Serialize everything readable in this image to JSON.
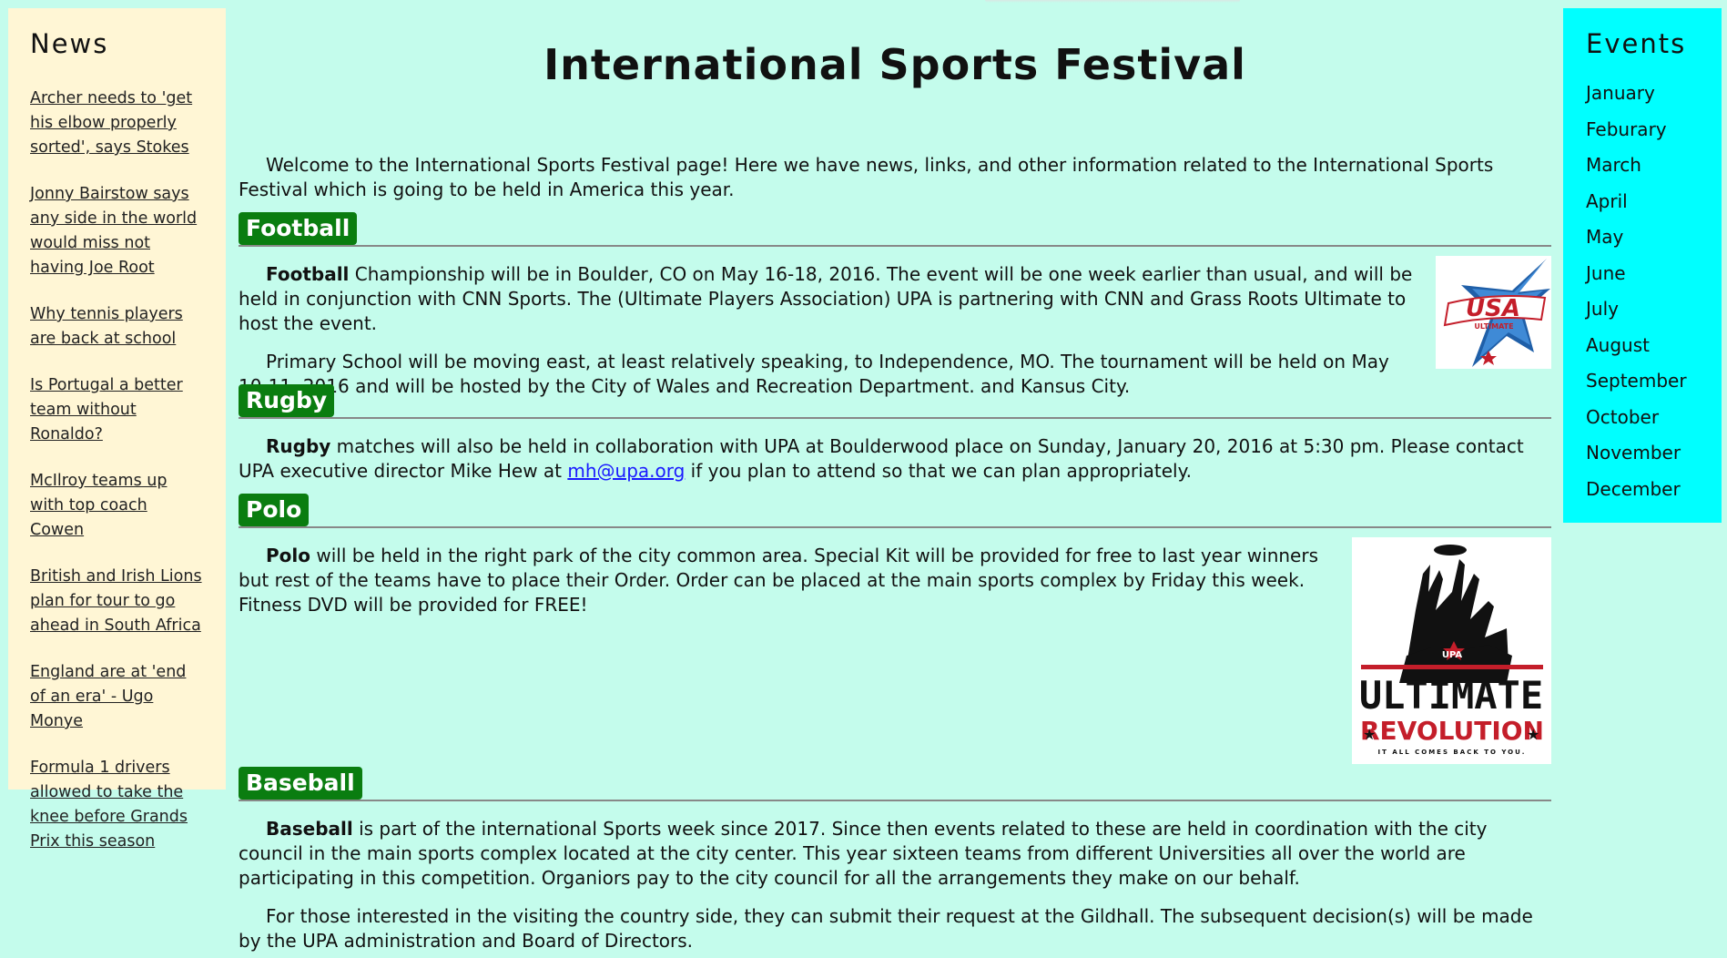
{
  "news": {
    "title": "News",
    "items": [
      "Archer needs to 'get his elbow properly sorted', says Stokes",
      "Jonny Bairstow says any side in the world would miss not having Joe Root",
      "Why tennis players are back at school",
      "Is Portugal a better team without Ronaldo?",
      "McIlroy teams up with top coach Cowen",
      "British and Irish Lions plan for tour to go ahead in South Africa",
      "England are at 'end of an era' - Ugo Monye",
      "Formula 1 drivers allowed to take the knee before Grands Prix this season"
    ]
  },
  "events": {
    "title": "Events",
    "months": [
      "January",
      "Feburary",
      "March",
      "April",
      "May",
      "June",
      "July",
      "August",
      "September",
      "October",
      "November",
      "December"
    ]
  },
  "main": {
    "title": "International Sports Festival",
    "intro": "Welcome to the International Sports Festival page! Here we have news, links, and other information related to the International Sports Festival which is going to be held in America this year.",
    "football": {
      "heading": "Football",
      "p1_bold": "Football",
      "p1_rest": " Championship will be in Boulder, CO on May 16-18, 2016. The event will be one week earlier than usual, and will be held in conjunction with CNN Sports. The (Ultimate Players Association) UPA is partnering with CNN and Grass Roots Ultimate to host the event.",
      "p2": "Primary School will be moving east, at least relatively speaking, to Independence, MO. The tournament will be held on May 10-11, 2016 and will be hosted by the City of Wales and Recreation Department. and Kansus City."
    },
    "rugby": {
      "heading": "Rugby",
      "p1_bold": "Rugby",
      "p1_before": " matches will also be held in collaboration with UPA at Boulderwood place on Sunday, January 20, 2016 at 5:30 pm. Please contact UPA executive director Mike Hew at ",
      "email": "mh@upa.org",
      "p1_after": " if you plan to attend so that we can plan appropriately."
    },
    "polo": {
      "heading": "Polo",
      "p1_bold": "Polo",
      "p1_rest": " will be held in the right park of the city common area. Special Kit will be provided for free to last year winners but rest of the teams have to place their Order. Order can be placed at the main sports complex by Friday this week. Fitness DVD will be provided for FREE!"
    },
    "baseball": {
      "heading": "Baseball",
      "p1_bold": "Baseball",
      "p1_rest": " is part of the international Sports week since 2017. Since then events related to these are held in coordination with the city council in the main sports complex located at the city center. This year sixteen teams from different Universities all over the world are participating in this competition. Organiors pay to the city council for all the arrangements they make on our behalf.",
      "p2": "For those interested in the visiting the country side, they can submit their request at the Gildhall. The subsequent decision(s) will be made by the UPA administration and Board of Directors."
    }
  },
  "logos": {
    "usa": {
      "text": "USA",
      "subtext": "ULTIMATE"
    },
    "upa": {
      "line1": "ULTIMATE",
      "line2": "REVOLUTION",
      "tagline": "IT ALL COMES BACK TO YOU.",
      "badge": "UPA"
    }
  },
  "colors": {
    "background": "#c4fcec",
    "news_bg": "#fff6d5",
    "events_bg": "#00ffff",
    "badge_green": "#0a7d10",
    "link_blue": "#1a1aff"
  }
}
